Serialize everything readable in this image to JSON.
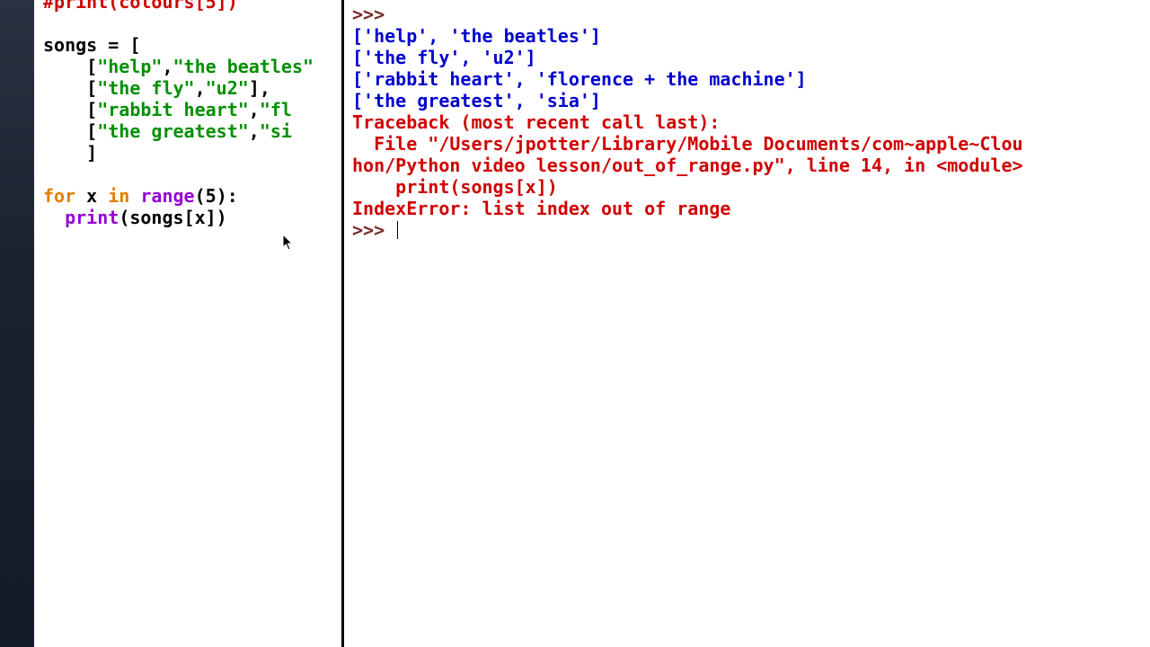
{
  "editor": {
    "comment": "#print(colours[5])",
    "songs_assign": "songs = [",
    "row_indent": "    [",
    "rows": [
      {
        "a": "\"help\"",
        "b": "\"the beatles\"",
        "tail": ","
      },
      {
        "a": "\"the fly\"",
        "b": "\"u2\"",
        "tail": "],"
      },
      {
        "a": "\"rabbit heart\"",
        "b": "\"florence + the machine\"",
        "tail": ","
      },
      {
        "a": "\"the greatest\"",
        "b": "\"sia\"",
        "tail": "]"
      }
    ],
    "close_bracket": "    ]",
    "for_line": {
      "kw_for": "for",
      "var": " x ",
      "kw_in": "in",
      "sp": " ",
      "range": "range",
      "args": "(5):"
    },
    "body_line": {
      "indent": "  ",
      "print": "print",
      "args": "(songs[x])"
    }
  },
  "shell": {
    "prompt": ">>>",
    "outputs": [
      "['help', 'the beatles']",
      "['the fly', 'u2']",
      "['rabbit heart', 'florence + the machine']",
      "['the greatest', 'sia']"
    ],
    "traceback": [
      "Traceback (most recent call last):",
      "  File \"/Users/jpotter/Library/Mobile Documents/com~apple~Clou",
      "hon/Python video lesson/out_of_range.py\", line 14, in <module>",
      "    print(songs[x])",
      "IndexError: list index out of range"
    ],
    "final_prompt": ">>> "
  }
}
